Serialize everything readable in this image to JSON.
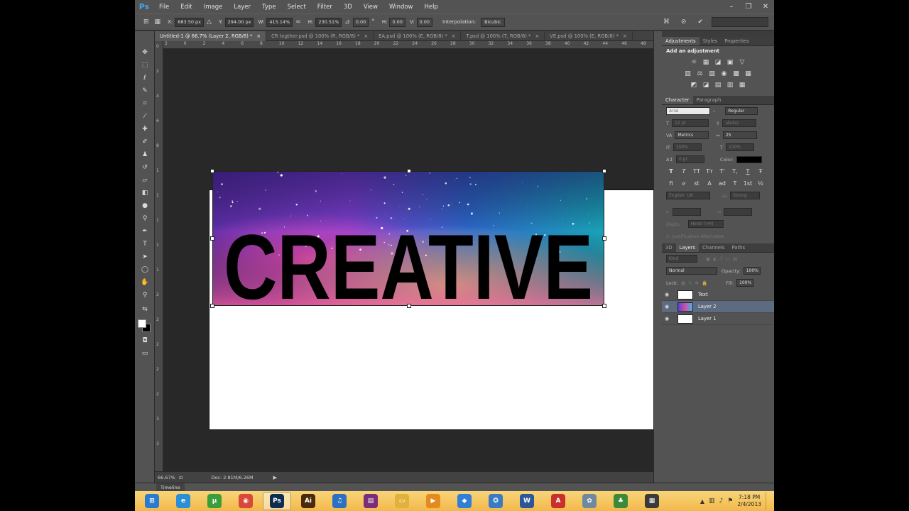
{
  "app": {
    "logo": "Ps",
    "menu": [
      "File",
      "Edit",
      "Image",
      "Layer",
      "Type",
      "Select",
      "Filter",
      "3D",
      "View",
      "Window",
      "Help"
    ],
    "window_controls": [
      "–",
      "❐",
      "✕"
    ]
  },
  "options_bar": {
    "x_label": "X:",
    "x_value": "683.50 px",
    "y_label": "Y:",
    "y_value": "294.00 px",
    "w_label": "W:",
    "w_value": "415.14%",
    "h_label": "H:",
    "h_value": "230.51%",
    "angle_value": "0.00",
    "hskew_label": "H:",
    "hskew_value": "0.00",
    "vskew_label": "V:",
    "vskew_value": "0.00",
    "interpolation_label": "Interpolation:",
    "interpolation_value": "Bicubic"
  },
  "tabs": [
    {
      "label": "Untitled-1 @ 66.7% (Layer 2, RGB/8) *",
      "close": "×"
    },
    {
      "label": "CR togther.psd @ 100% (R, RGB/8) *",
      "close": "×"
    },
    {
      "label": "EA.psd @ 100% (E, RGB/8) *",
      "close": "×"
    },
    {
      "label": "T.psd @ 100% (T, RGB/8) *",
      "close": "×"
    },
    {
      "label": "VE.psd @ 100% (E, RGB/8) *",
      "close": "×"
    }
  ],
  "ruler": {
    "top": [
      "2",
      "0",
      "2",
      "4",
      "6",
      "8",
      "10",
      "12",
      "14",
      "16",
      "18",
      "20",
      "22",
      "24",
      "26",
      "28",
      "30",
      "32",
      "34",
      "36",
      "38",
      "40",
      "42",
      "44",
      "46",
      "48"
    ],
    "left": [
      "0",
      "2",
      "4",
      "6",
      "8",
      "1",
      "1",
      "1",
      "1",
      "1",
      "2",
      "2",
      "2",
      "2",
      "2",
      "3",
      "3"
    ]
  },
  "canvas": {
    "word": "CREATIVE"
  },
  "status": {
    "zoom": "66.67%",
    "doc": "Doc: 2.81M/6.26M",
    "arrow": "▶"
  },
  "timeline": {
    "label": "Timeline"
  },
  "adjustments": {
    "tabs": [
      "Adjustments",
      "Styles",
      "Properties"
    ],
    "title": "Add an adjustment",
    "icons": [
      [
        "☼",
        "▦",
        "◪",
        "▣",
        "▽"
      ],
      [
        "▥",
        "⚖",
        "▧",
        "◉",
        "▩",
        "▦"
      ],
      [
        "◩",
        "◪",
        "▤",
        "▥",
        "▦"
      ]
    ]
  },
  "character": {
    "tabs": [
      "Character",
      "Paragraph"
    ],
    "font_family": "Arial",
    "font_style": "Regular",
    "size": "12 pt",
    "leading": "(Auto)",
    "kerning": "Metrics",
    "tracking": "25",
    "vscale": "100%",
    "hscale": "100%",
    "baseline": "0 pt",
    "color_label": "Color:",
    "color_value": "#000000",
    "styles": [
      "T",
      "T",
      "TT",
      "Tт",
      "T'",
      "T,",
      "T",
      "Ŧ"
    ],
    "opentype": [
      "fi",
      "ℯ",
      "st",
      "A",
      "ad",
      "T",
      "1st",
      "½"
    ],
    "language": "English: UK",
    "aa_label": "aa",
    "aa_value": "Strong",
    "digits_label": "Digits:",
    "digits_value": "Hindi (١٢٣)",
    "justification": "Justification Alternates"
  },
  "layers": {
    "tabs": [
      "3D",
      "Layers",
      "Channels",
      "Paths"
    ],
    "filter": "Kind",
    "blend": "Normal",
    "opacity_label": "Opacity:",
    "opacity": "100%",
    "lock_label": "Lock:",
    "fill_label": "Fill:",
    "fill": "100%",
    "items": [
      {
        "name": "Text",
        "visible": "◉",
        "selected": false
      },
      {
        "name": "Layer 2",
        "visible": "◉",
        "selected": true
      },
      {
        "name": "Layer 1",
        "visible": "◉",
        "selected": false
      }
    ]
  },
  "taskbar": {
    "items": [
      {
        "name": "start",
        "glyph": "⊞",
        "color": "#2a7bd0"
      },
      {
        "name": "internet-explorer",
        "glyph": "e",
        "color": "#2b8fd6"
      },
      {
        "name": "utorrent",
        "glyph": "µ",
        "color": "#3a9f3a"
      },
      {
        "name": "chrome",
        "glyph": "◉",
        "color": "#d9483b"
      },
      {
        "name": "photoshop",
        "glyph": "Ps",
        "color": "#0b2d4f"
      },
      {
        "name": "illustrator",
        "glyph": "Ai",
        "color": "#4a2a08"
      },
      {
        "name": "itunes",
        "glyph": "♫",
        "color": "#2d6fc0"
      },
      {
        "name": "winrar",
        "glyph": "▤",
        "color": "#7a2d7a"
      },
      {
        "name": "explorer",
        "glyph": "▭",
        "color": "#e2b13c"
      },
      {
        "name": "media-player",
        "glyph": "▶",
        "color": "#e48a1f"
      },
      {
        "name": "app-diamond",
        "glyph": "◆",
        "color": "#2f7ed8"
      },
      {
        "name": "app-ball",
        "glyph": "✪",
        "color": "#3b7bc4"
      },
      {
        "name": "word",
        "glyph": "W",
        "color": "#2b579a"
      },
      {
        "name": "acrobat",
        "glyph": "A",
        "color": "#c9302c"
      },
      {
        "name": "app-gear",
        "glyph": "✿",
        "color": "#6f8aa0"
      },
      {
        "name": "app-tree",
        "glyph": "♣",
        "color": "#3a8a3a"
      },
      {
        "name": "app-film",
        "glyph": "▦",
        "color": "#3a3a3a"
      }
    ],
    "time": "7:18 PM",
    "date": "2/4/2013"
  }
}
